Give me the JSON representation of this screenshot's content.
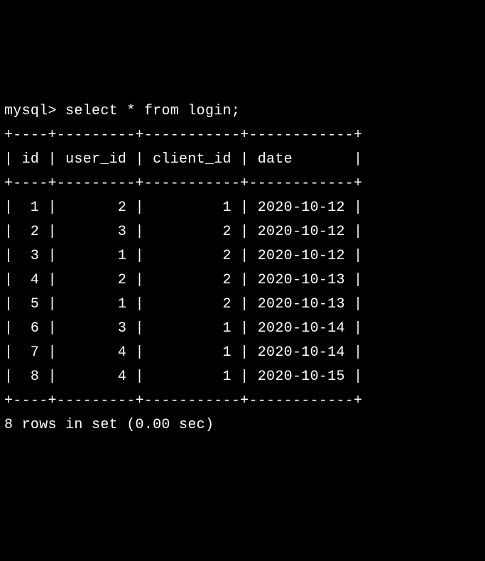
{
  "prompt_prefix": "mysql> ",
  "query": "select * from login;",
  "chart_data": {
    "type": "table",
    "columns": [
      "id",
      "user_id",
      "client_id",
      "date"
    ],
    "rows": [
      {
        "id": 1,
        "user_id": 2,
        "client_id": 1,
        "date": "2020-10-12"
      },
      {
        "id": 2,
        "user_id": 3,
        "client_id": 2,
        "date": "2020-10-12"
      },
      {
        "id": 3,
        "user_id": 1,
        "client_id": 2,
        "date": "2020-10-12"
      },
      {
        "id": 4,
        "user_id": 2,
        "client_id": 2,
        "date": "2020-10-13"
      },
      {
        "id": 5,
        "user_id": 1,
        "client_id": 2,
        "date": "2020-10-13"
      },
      {
        "id": 6,
        "user_id": 3,
        "client_id": 1,
        "date": "2020-10-14"
      },
      {
        "id": 7,
        "user_id": 4,
        "client_id": 1,
        "date": "2020-10-14"
      },
      {
        "id": 8,
        "user_id": 4,
        "client_id": 1,
        "date": "2020-10-15"
      }
    ]
  },
  "col_widths": {
    "id": 4,
    "user_id": 9,
    "client_id": 11,
    "date": 12
  },
  "footer": "8 rows in set (0.00 sec)"
}
